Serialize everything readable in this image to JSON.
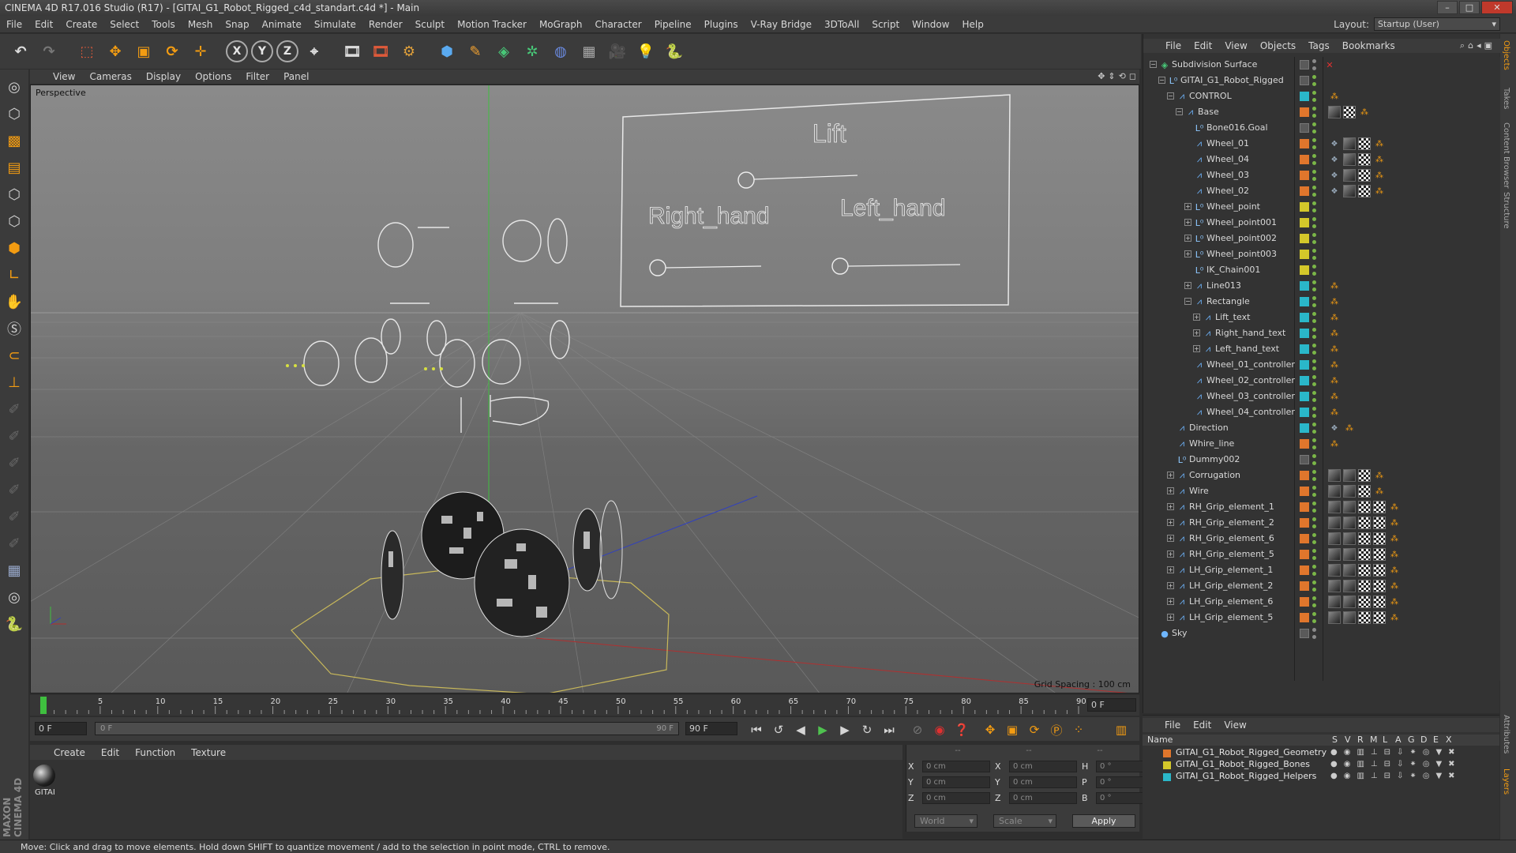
{
  "window": {
    "title": "CINEMA 4D R17.016 Studio (R17) - [GITAI_G1_Robot_Rigged_c4d_standart.c4d *] - Main",
    "buttons": [
      "–",
      "□",
      "✕"
    ]
  },
  "menubar": {
    "items": [
      "File",
      "Edit",
      "Create",
      "Select",
      "Tools",
      "Mesh",
      "Snap",
      "Animate",
      "Simulate",
      "Render",
      "Sculpt",
      "Motion Tracker",
      "MoGraph",
      "Character",
      "Pipeline",
      "Plugins",
      "V-Ray Bridge",
      "3DToAll",
      "Script",
      "Window",
      "Help"
    ],
    "layout_label": "Layout:",
    "layout_value": "Startup (User)"
  },
  "toolbar": {
    "icons": [
      "undo-icon",
      "redo-icon",
      "live-selection-icon",
      "move-icon",
      "scale-icon",
      "rotate-icon",
      "transform-icon",
      "x-axis-icon",
      "y-axis-icon",
      "z-axis-icon",
      "world-coords-icon",
      "render-view-icon",
      "render-picture-viewer-icon",
      "edit-render-settings-icon",
      "cube-icon",
      "pen-icon",
      "subdivision-icon",
      "cloner-icon",
      "deformer-icon",
      "floor-icon",
      "camera-icon",
      "light-icon",
      "python-icon"
    ],
    "axis_labels": [
      "X",
      "Y",
      "Z"
    ]
  },
  "viewport": {
    "menu": [
      "View",
      "Cameras",
      "Display",
      "Options",
      "Filter",
      "Panel"
    ],
    "label": "Perspective",
    "grid_spacing": "Grid Spacing : 100 cm",
    "control_panel": {
      "title": "Lift",
      "right_hand": "Right_hand",
      "left_hand": "Left_hand"
    }
  },
  "timeline": {
    "ticks": [
      "0",
      "5",
      "10",
      "15",
      "20",
      "25",
      "30",
      "35",
      "40",
      "45",
      "50",
      "55",
      "60",
      "65",
      "70",
      "75",
      "80",
      "85",
      "90"
    ],
    "current_frame": "0 F",
    "start_field": "0 F",
    "range_start": "0 F",
    "range_end": "90 F",
    "end_field": "90 F"
  },
  "material_manager": {
    "menu": [
      "Create",
      "Edit",
      "Function",
      "Texture"
    ],
    "material_name": "GITAI"
  },
  "coordinates": {
    "header": [
      "--",
      "--",
      "--"
    ],
    "rows": [
      {
        "axis": "X",
        "pos": "0 cm",
        "size_axis": "X",
        "size": "0 cm",
        "rot_axis": "H",
        "rot": "0 °"
      },
      {
        "axis": "Y",
        "pos": "0 cm",
        "size_axis": "Y",
        "size": "0 cm",
        "rot_axis": "P",
        "rot": "0 °"
      },
      {
        "axis": "Z",
        "pos": "0 cm",
        "size_axis": "Z",
        "size": "0 cm",
        "rot_axis": "B",
        "rot": "0 °"
      }
    ],
    "mode": "World",
    "size_mode": "Scale",
    "apply": "Apply"
  },
  "status": "Move: Click and drag to move elements. Hold down SHIFT to quantize movement / add to the selection in point mode, CTRL to remove.",
  "object_manager": {
    "menu": [
      "File",
      "Edit",
      "View",
      "Objects",
      "Tags",
      "Bookmarks"
    ],
    "objects": [
      {
        "name": "Subdivision Surface",
        "indent": 0,
        "expand": "−",
        "type": "subdiv",
        "layer": "",
        "tags": []
      },
      {
        "name": "GITAI_G1_Robot_Rigged",
        "indent": 1,
        "expand": "−",
        "type": "null",
        "layer": "",
        "tags": []
      },
      {
        "name": "CONTROL",
        "indent": 2,
        "expand": "−",
        "type": "spline",
        "layer": "#2ab7c9",
        "tags": [
          "joint"
        ]
      },
      {
        "name": "Base",
        "indent": 3,
        "expand": "−",
        "type": "spline",
        "layer": "#e0762c",
        "tags": [
          "tex",
          "checker",
          "joint"
        ]
      },
      {
        "name": "Bone016.Goal",
        "indent": 4,
        "expand": "",
        "type": "null",
        "layer": "",
        "tags": []
      },
      {
        "name": "Wheel_01",
        "indent": 4,
        "expand": "",
        "type": "spline",
        "layer": "#e0762c",
        "tags": [
          "vray",
          "tex",
          "checker",
          "joint"
        ]
      },
      {
        "name": "Wheel_04",
        "indent": 4,
        "expand": "",
        "type": "spline",
        "layer": "#e0762c",
        "tags": [
          "vray",
          "tex",
          "checker",
          "joint"
        ]
      },
      {
        "name": "Wheel_03",
        "indent": 4,
        "expand": "",
        "type": "spline",
        "layer": "#e0762c",
        "tags": [
          "vray",
          "tex",
          "checker",
          "joint"
        ]
      },
      {
        "name": "Wheel_02",
        "indent": 4,
        "expand": "",
        "type": "spline",
        "layer": "#e0762c",
        "tags": [
          "vray",
          "tex",
          "checker",
          "joint"
        ]
      },
      {
        "name": "Wheel_point",
        "indent": 4,
        "expand": "+",
        "type": "null",
        "layer": "#d4c82a",
        "tags": []
      },
      {
        "name": "Wheel_point001",
        "indent": 4,
        "expand": "+",
        "type": "null",
        "layer": "#d4c82a",
        "tags": []
      },
      {
        "name": "Wheel_point002",
        "indent": 4,
        "expand": "+",
        "type": "null",
        "layer": "#d4c82a",
        "tags": []
      },
      {
        "name": "Wheel_point003",
        "indent": 4,
        "expand": "+",
        "type": "null",
        "layer": "#d4c82a",
        "tags": []
      },
      {
        "name": "IK_Chain001",
        "indent": 4,
        "expand": "",
        "type": "null",
        "layer": "#d4c82a",
        "tags": []
      },
      {
        "name": "Line013",
        "indent": 4,
        "expand": "+",
        "type": "spline",
        "layer": "#2ab7c9",
        "tags": [
          "joint"
        ]
      },
      {
        "name": "Rectangle",
        "indent": 4,
        "expand": "−",
        "type": "spline",
        "layer": "#2ab7c9",
        "tags": [
          "joint"
        ]
      },
      {
        "name": "Lift_text",
        "indent": 5,
        "expand": "+",
        "type": "spline",
        "layer": "#2ab7c9",
        "tags": [
          "joint"
        ]
      },
      {
        "name": "Right_hand_text",
        "indent": 5,
        "expand": "+",
        "type": "spline",
        "layer": "#2ab7c9",
        "tags": [
          "joint"
        ]
      },
      {
        "name": "Left_hand_text",
        "indent": 5,
        "expand": "+",
        "type": "spline",
        "layer": "#2ab7c9",
        "tags": [
          "joint"
        ]
      },
      {
        "name": "Wheel_01_controller",
        "indent": 4,
        "expand": "",
        "type": "spline",
        "layer": "#2ab7c9",
        "tags": [
          "joint"
        ]
      },
      {
        "name": "Wheel_02_controller",
        "indent": 4,
        "expand": "",
        "type": "spline",
        "layer": "#2ab7c9",
        "tags": [
          "joint"
        ]
      },
      {
        "name": "Wheel_03_controller",
        "indent": 4,
        "expand": "",
        "type": "spline",
        "layer": "#2ab7c9",
        "tags": [
          "joint"
        ]
      },
      {
        "name": "Wheel_04_controller",
        "indent": 4,
        "expand": "",
        "type": "spline",
        "layer": "#2ab7c9",
        "tags": [
          "joint"
        ]
      },
      {
        "name": "Direction",
        "indent": 2,
        "expand": "",
        "type": "spline",
        "layer": "#2ab7c9",
        "tags": [
          "vray",
          "joint"
        ]
      },
      {
        "name": "Whire_line",
        "indent": 2,
        "expand": "",
        "type": "spline",
        "layer": "#e0762c",
        "tags": [
          "joint"
        ]
      },
      {
        "name": "Dummy002",
        "indent": 2,
        "expand": "",
        "type": "null",
        "layer": "",
        "tags": []
      },
      {
        "name": "Corrugation",
        "indent": 2,
        "expand": "+",
        "type": "spline",
        "layer": "#e0762c",
        "tags": [
          "tex",
          "tex",
          "checker",
          "joint"
        ]
      },
      {
        "name": "Wire",
        "indent": 2,
        "expand": "+",
        "type": "spline",
        "layer": "#e0762c",
        "tags": [
          "tex",
          "tex",
          "checker",
          "joint"
        ]
      },
      {
        "name": "RH_Grip_element_1",
        "indent": 2,
        "expand": "+",
        "type": "spline",
        "layer": "#e0762c",
        "tags": [
          "tex",
          "tex",
          "checker",
          "checker",
          "joint"
        ]
      },
      {
        "name": "RH_Grip_element_2",
        "indent": 2,
        "expand": "+",
        "type": "spline",
        "layer": "#e0762c",
        "tags": [
          "tex",
          "tex",
          "checker",
          "checker",
          "joint"
        ]
      },
      {
        "name": "RH_Grip_element_6",
        "indent": 2,
        "expand": "+",
        "type": "spline",
        "layer": "#e0762c",
        "tags": [
          "tex",
          "tex",
          "checker",
          "checker",
          "joint"
        ]
      },
      {
        "name": "RH_Grip_element_5",
        "indent": 2,
        "expand": "+",
        "type": "spline",
        "layer": "#e0762c",
        "tags": [
          "tex",
          "tex",
          "checker",
          "checker",
          "joint"
        ]
      },
      {
        "name": "LH_Grip_element_1",
        "indent": 2,
        "expand": "+",
        "type": "spline",
        "layer": "#e0762c",
        "tags": [
          "tex",
          "tex",
          "checker",
          "checker",
          "joint"
        ]
      },
      {
        "name": "LH_Grip_element_2",
        "indent": 2,
        "expand": "+",
        "type": "spline",
        "layer": "#e0762c",
        "tags": [
          "tex",
          "tex",
          "checker",
          "checker",
          "joint"
        ]
      },
      {
        "name": "LH_Grip_element_6",
        "indent": 2,
        "expand": "+",
        "type": "spline",
        "layer": "#e0762c",
        "tags": [
          "tex",
          "tex",
          "checker",
          "checker",
          "joint"
        ]
      },
      {
        "name": "LH_Grip_element_5",
        "indent": 2,
        "expand": "+",
        "type": "spline",
        "layer": "#e0762c",
        "tags": [
          "tex",
          "tex",
          "checker",
          "checker",
          "joint"
        ]
      },
      {
        "name": "Sky",
        "indent": 0,
        "expand": "",
        "type": "sky",
        "layer": "",
        "tags": []
      }
    ]
  },
  "side_tabs": [
    "Objects",
    "Takes",
    "Content Browser",
    "Structure"
  ],
  "side_tabs_bottom": [
    "Attributes",
    "Layers"
  ],
  "layer_manager": {
    "menu": [
      "File",
      "Edit",
      "View"
    ],
    "columns": [
      "Name",
      "S",
      "V",
      "R",
      "M",
      "L",
      "A",
      "G",
      "D",
      "E",
      "X"
    ],
    "layers": [
      {
        "name": "GITAI_G1_Robot_Rigged_Geometry",
        "color": "#e0762c"
      },
      {
        "name": "GITAI_G1_Robot_Rigged_Bones",
        "color": "#d4c82a"
      },
      {
        "name": "GITAI_G1_Robot_Rigged_Helpers",
        "color": "#2ab7c9"
      }
    ]
  },
  "colors": {
    "accent": "#f39c12",
    "viewport_bg": "#7d7d7d",
    "panel_bg": "#333333"
  }
}
